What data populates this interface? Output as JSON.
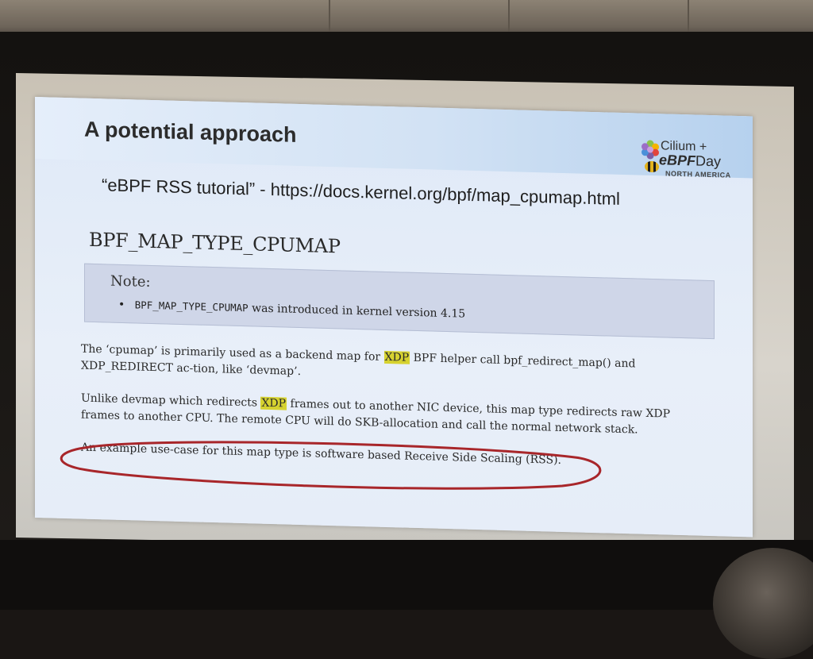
{
  "slide": {
    "title": "A potential approach",
    "logo": {
      "line1": "Cilium +",
      "line2_a": "eBPF",
      "line2_b": "Day",
      "line3": "NORTH AMERICA"
    },
    "subtitle": "“eBPF RSS tutorial” - https://docs.kernel.org/bpf/map_cpumap.html",
    "doc_heading": "BPF_MAP_TYPE_CPUMAP",
    "note": {
      "title": "Note:",
      "item_code": "BPF_MAP_TYPE_CPUMAP",
      "item_text": "was introduced in kernel version 4.15"
    },
    "paragraph1": {
      "before": "The ‘cpumap’ is primarily used as a backend map for",
      "highlight": "XDP",
      "after": "BPF helper call bpf_redirect_map() and XDP_REDIRECT ac-tion, like ‘devmap’."
    },
    "paragraph2": {
      "before": "Unlike devmap which redirects",
      "highlight": "XDP",
      "after": "frames out to another NIC device, this map type redirects raw XDP frames to another CPU. The remote CPU will do SKB-allocation and call the normal network stack."
    },
    "paragraph3": "An example use-case for this map type is software based Receive Side Scaling (RSS).",
    "colors": {
      "highlight": "#d6d230",
      "annotation": "#a8262a",
      "slide_background": "#e6edf8"
    }
  }
}
